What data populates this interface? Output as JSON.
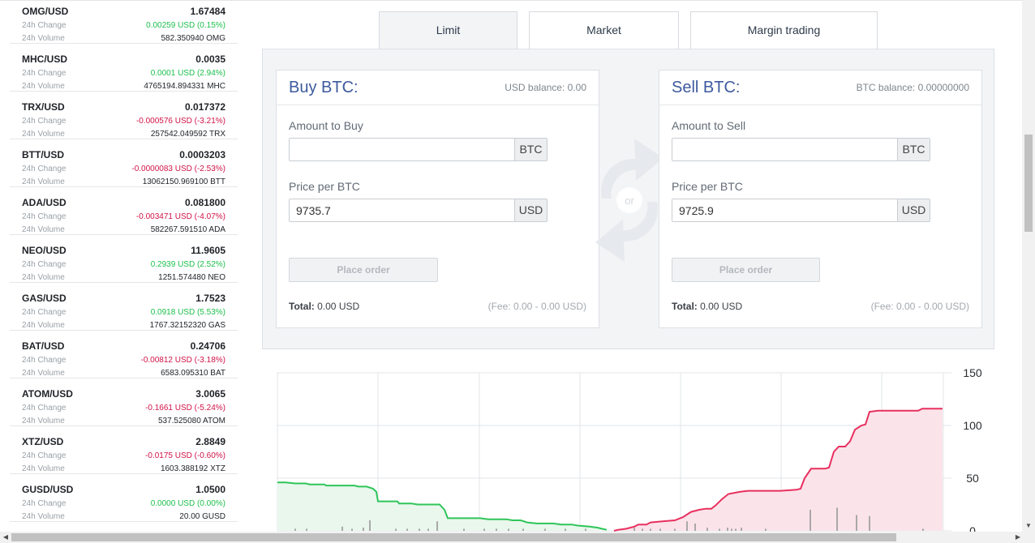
{
  "markets": [
    {
      "pair": "OMG/USD",
      "price": "1.67484",
      "change_label": "24h Change",
      "change": "0.00259 USD (0.15%)",
      "dir": "up",
      "volume_label": "24h Volume",
      "volume": "582.350940 OMG"
    },
    {
      "pair": "MHC/USD",
      "price": "0.0035",
      "change_label": "24h Change",
      "change": "0.0001 USD (2.94%)",
      "dir": "up",
      "volume_label": "24h Volume",
      "volume": "4765194.894331 MHC"
    },
    {
      "pair": "TRX/USD",
      "price": "0.017372",
      "change_label": "24h Change",
      "change": "-0.000576 USD (-3.21%)",
      "dir": "down",
      "volume_label": "24h Volume",
      "volume": "257542.049592 TRX"
    },
    {
      "pair": "BTT/USD",
      "price": "0.0003203",
      "change_label": "24h Change",
      "change": "-0.0000083 USD (-2.53%)",
      "dir": "down",
      "volume_label": "24h Volume",
      "volume": "13062150.969100 BTT"
    },
    {
      "pair": "ADA/USD",
      "price": "0.081800",
      "change_label": "24h Change",
      "change": "-0.003471 USD (-4.07%)",
      "dir": "down",
      "volume_label": "24h Volume",
      "volume": "582267.591510 ADA"
    },
    {
      "pair": "NEO/USD",
      "price": "11.9605",
      "change_label": "24h Change",
      "change": "0.2939 USD (2.52%)",
      "dir": "up",
      "volume_label": "24h Volume",
      "volume": "1251.574480 NEO"
    },
    {
      "pair": "GAS/USD",
      "price": "1.7523",
      "change_label": "24h Change",
      "change": "0.0918 USD (5.53%)",
      "dir": "up",
      "volume_label": "24h Volume",
      "volume": "1767.32152320 GAS"
    },
    {
      "pair": "BAT/USD",
      "price": "0.24706",
      "change_label": "24h Change",
      "change": "-0.00812 USD (-3.18%)",
      "dir": "down",
      "volume_label": "24h Volume",
      "volume": "6583.095310 BAT"
    },
    {
      "pair": "ATOM/USD",
      "price": "3.0065",
      "change_label": "24h Change",
      "change": "-0.1661 USD (-5.24%)",
      "dir": "down",
      "volume_label": "24h Volume",
      "volume": "537.525080 ATOM"
    },
    {
      "pair": "XTZ/USD",
      "price": "2.8849",
      "change_label": "24h Change",
      "change": "-0.0175 USD (-0.60%)",
      "dir": "down",
      "volume_label": "24h Volume",
      "volume": "1603.388192 XTZ"
    },
    {
      "pair": "GUSD/USD",
      "price": "1.0500",
      "change_label": "24h Change",
      "change": "0.0000 USD (0.00%)",
      "dir": "up",
      "volume_label": "24h Volume",
      "volume": "20.00 GUSD"
    }
  ],
  "tabs": {
    "limit": "Limit",
    "market": "Market",
    "margin": "Margin trading",
    "active": "limit"
  },
  "buy": {
    "title": "Buy BTC:",
    "balance": "USD balance: 0.00",
    "amount_label": "Amount to Buy",
    "amount_value": "",
    "amount_unit": "BTC",
    "price_label": "Price per BTC",
    "price_value": "9735.7",
    "price_unit": "USD",
    "button": "Place order",
    "total_label": "Total:",
    "total_value": "0.00 USD",
    "fee": "(Fee: 0.00 - 0.00 USD)"
  },
  "sell": {
    "title": "Sell BTC:",
    "balance": "BTC balance: 0.00000000",
    "amount_label": "Amount to Sell",
    "amount_value": "",
    "amount_unit": "BTC",
    "price_label": "Price per BTC",
    "price_value": "9725.9",
    "price_unit": "USD",
    "button": "Place order",
    "total_label": "Total:",
    "total_value": "0.00 USD",
    "fee": "(Fee: 0.00 - 0.00 USD)"
  },
  "swap_or": "or",
  "icons": {
    "swap": "swap-arrows-icon",
    "scroll_down": "triangle-down-icon",
    "scroll_left": "triangle-left-icon",
    "scroll_right": "triangle-right-icon"
  },
  "colors": {
    "buy_line": "#2fc55a",
    "buy_fill": "#e9f7ec",
    "sell_line": "#e8305f",
    "sell_fill": "#fbe3ea",
    "up": "#1cbf4c",
    "down": "#d11249",
    "title": "#3d5a9e"
  },
  "chart_data": {
    "type": "area",
    "title": "",
    "xlabel": "",
    "ylabel": "",
    "ylim": [
      0,
      150
    ],
    "y_ticks": [
      "150",
      "100",
      "50",
      "0"
    ],
    "y_tick_values": [
      150,
      100,
      50,
      0
    ],
    "x_ticks": [],
    "grid": true,
    "legend": "none",
    "series": [
      {
        "name": "",
        "side": "bid",
        "values": [
          [
            0,
            46
          ],
          [
            10,
            46
          ],
          [
            22,
            45
          ],
          [
            35,
            45
          ],
          [
            40,
            44
          ],
          [
            58,
            44
          ],
          [
            60,
            43
          ],
          [
            95,
            43
          ],
          [
            100,
            42
          ],
          [
            110,
            42
          ],
          [
            118,
            40
          ],
          [
            122,
            37
          ],
          [
            124,
            28
          ],
          [
            148,
            28
          ],
          [
            150,
            26
          ],
          [
            155,
            26
          ],
          [
            165,
            26
          ],
          [
            173,
            25
          ],
          [
            200,
            25
          ],
          [
            206,
            20
          ],
          [
            210,
            12
          ],
          [
            230,
            12
          ],
          [
            250,
            12
          ],
          [
            260,
            11
          ],
          [
            282,
            11
          ],
          [
            290,
            10
          ],
          [
            300,
            10
          ],
          [
            308,
            8
          ],
          [
            320,
            7
          ],
          [
            340,
            7
          ],
          [
            350,
            6
          ],
          [
            363,
            6
          ],
          [
            370,
            5
          ],
          [
            385,
            4
          ],
          [
            395,
            3
          ],
          [
            400,
            2
          ],
          [
            406,
            1
          ]
        ]
      },
      {
        "name": "",
        "side": "ask",
        "values": [
          [
            415,
            0
          ],
          [
            420,
            1
          ],
          [
            430,
            2
          ],
          [
            440,
            4
          ],
          [
            445,
            6
          ],
          [
            455,
            6
          ],
          [
            460,
            8
          ],
          [
            475,
            9
          ],
          [
            490,
            10
          ],
          [
            500,
            13
          ],
          [
            510,
            18
          ],
          [
            520,
            20
          ],
          [
            528,
            21
          ],
          [
            535,
            21
          ],
          [
            540,
            24
          ],
          [
            548,
            30
          ],
          [
            556,
            35
          ],
          [
            570,
            37
          ],
          [
            580,
            38
          ],
          [
            600,
            38
          ],
          [
            620,
            38
          ],
          [
            640,
            39
          ],
          [
            645,
            40
          ],
          [
            650,
            50
          ],
          [
            658,
            59
          ],
          [
            675,
            59
          ],
          [
            680,
            60
          ],
          [
            686,
            75
          ],
          [
            692,
            80
          ],
          [
            700,
            80
          ],
          [
            706,
            85
          ],
          [
            712,
            96
          ],
          [
            720,
            100
          ],
          [
            725,
            101
          ],
          [
            730,
            113
          ],
          [
            740,
            114
          ],
          [
            770,
            114
          ],
          [
            790,
            114
          ],
          [
            795,
            116
          ],
          [
            808,
            116
          ],
          [
            820,
            116
          ]
        ]
      }
    ],
    "volume_bars": [
      [
        22,
        2
      ],
      [
        36,
        2
      ],
      [
        80,
        4
      ],
      [
        92,
        2
      ],
      [
        106,
        3
      ],
      [
        114,
        10
      ],
      [
        146,
        2
      ],
      [
        160,
        2
      ],
      [
        175,
        2
      ],
      [
        186,
        2
      ],
      [
        197,
        9
      ],
      [
        230,
        2
      ],
      [
        255,
        2
      ],
      [
        270,
        2
      ],
      [
        285,
        2
      ],
      [
        303,
        2
      ],
      [
        330,
        2
      ],
      [
        355,
        2
      ],
      [
        380,
        2
      ],
      [
        440,
        3
      ],
      [
        450,
        2
      ],
      [
        460,
        2
      ],
      [
        472,
        2
      ],
      [
        490,
        2
      ],
      [
        505,
        9
      ],
      [
        515,
        7
      ],
      [
        530,
        3
      ],
      [
        545,
        2
      ],
      [
        555,
        3
      ],
      [
        560,
        2
      ],
      [
        565,
        2
      ],
      [
        572,
        3
      ],
      [
        602,
        2
      ],
      [
        657,
        20
      ],
      [
        690,
        22
      ],
      [
        714,
        15
      ],
      [
        730,
        14
      ],
      [
        796,
        2
      ]
    ]
  }
}
